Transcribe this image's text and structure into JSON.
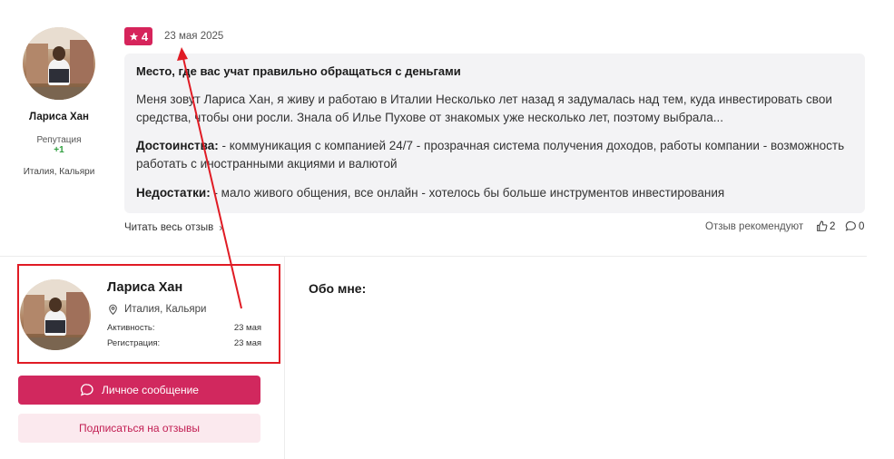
{
  "review": {
    "author": {
      "name": "Лариса Хан",
      "reputation_label": "Репутация",
      "reputation_value": "+1",
      "location": "Италия, Кальяри"
    },
    "rating": "4",
    "date": "23 мая 2025",
    "title": "Место, где вас учат правильно обращаться с деньгами",
    "text": "Меня зовут Лариса Хан, я живу и работаю в Италии Несколько лет назад я задумалась над тем, куда инвестировать свои средства, чтобы они росли. Знала об Илье Пухове от знакомых уже несколько лет, поэтому выбрала...",
    "pros_label": "Достоинства:",
    "pros_text": " - коммуникация с компанией 24/7 - прозрачная система получения доходов, работы компании - возможность работать с иностранными акциями и валютой",
    "cons_label": "Недостатки:",
    "cons_text": " - мало живого общения, все онлайн - хотелось бы больше инструментов инвестирования",
    "read_more": "Читать весь отзыв",
    "recommended": "Отзыв рекомендуют",
    "likes": "2",
    "comments": "0"
  },
  "profile": {
    "name": "Лариса Хан",
    "location": "Италия, Кальяри",
    "activity_label": "Активность:",
    "activity_value": "23 мая",
    "registration_label": "Регистрация:",
    "registration_value": "23 мая",
    "message_button": "Личное сообщение",
    "subscribe_button": "Подписаться на отзывы",
    "about_label": "Обо мне:"
  },
  "colors": {
    "accent": "#d6245b",
    "highlight_box": "#e01b24",
    "secondary_bg": "#fbe9ee"
  }
}
